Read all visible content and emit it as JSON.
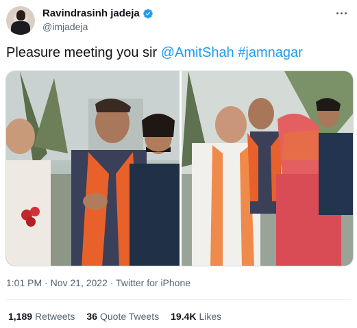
{
  "author": {
    "name": "Ravindrasinh jadeja",
    "handle": "@imjadeja",
    "verified": true,
    "verified_color": "#1d9bf0",
    "avatar_icon": "profile-photo"
  },
  "more_icon": "more-options-icon",
  "tweet": {
    "text_prefix": "Pleasure meeting you sir ",
    "mention": "@AmitShah",
    "hashtag": "#jamnagar",
    "link_color": "#1d9bf0"
  },
  "media": {
    "photos": [
      "photo-left",
      "photo-right"
    ]
  },
  "meta": {
    "time": "1:01 PM",
    "separator1": " · ",
    "date": "Nov 21, 2022",
    "separator2": " · ",
    "source": "Twitter for iPhone"
  },
  "stats": {
    "retweets_count": "1,189",
    "retweets_label": "Retweets",
    "quotes_count": "36",
    "quotes_label": "Quote Tweets",
    "likes_count": "19.4K",
    "likes_label": "Likes"
  }
}
